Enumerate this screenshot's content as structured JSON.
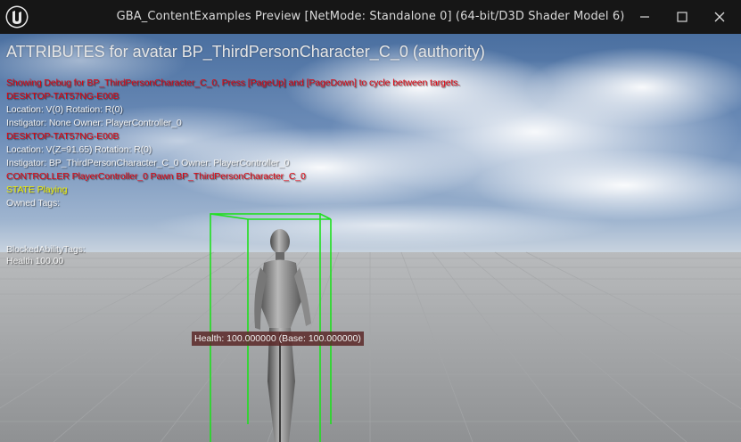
{
  "window": {
    "title": "GBA_ContentExamples Preview [NetMode: Standalone 0]  (64-bit/D3D Shader Model 6)",
    "controls": [
      "minimize",
      "maximize",
      "close"
    ]
  },
  "overlay": {
    "heading": "ATTRIBUTES for avatar BP_ThirdPersonCharacter_C_0 (authority)",
    "lines": [
      "Showing Debug for BP_ThirdPersonCharacter_C_0, Press [PageUp] and [PageDown] to cycle between targets.",
      "DESKTOP-TAT57NG-E00B",
      "Location: V(0) Rotation: R(0)",
      " Instigator: None Owner: PlayerController_0",
      "DESKTOP-TAT57NG-E00B",
      "Location: V(Z=91.65) Rotation: R(0)",
      " Instigator: BP_ThirdPersonCharacter_C_0 Owner: PlayerController_0",
      "CONTROLLER PlayerController_0 Pawn BP_ThirdPersonCharacter_C_0",
      "STATE Playing",
      "Owned Tags:",
      "BlockedAbilityTags:",
      "Health 100.00"
    ],
    "health_tag": "Health: 100.000000 (Base: 100.000000)"
  },
  "colors": {
    "debug_red": "#e0000b",
    "debug_white": "#f2f2f2",
    "debug_yellow": "#f0f000",
    "bounds_green": "#1ee01e",
    "titlebar": "#161616"
  }
}
